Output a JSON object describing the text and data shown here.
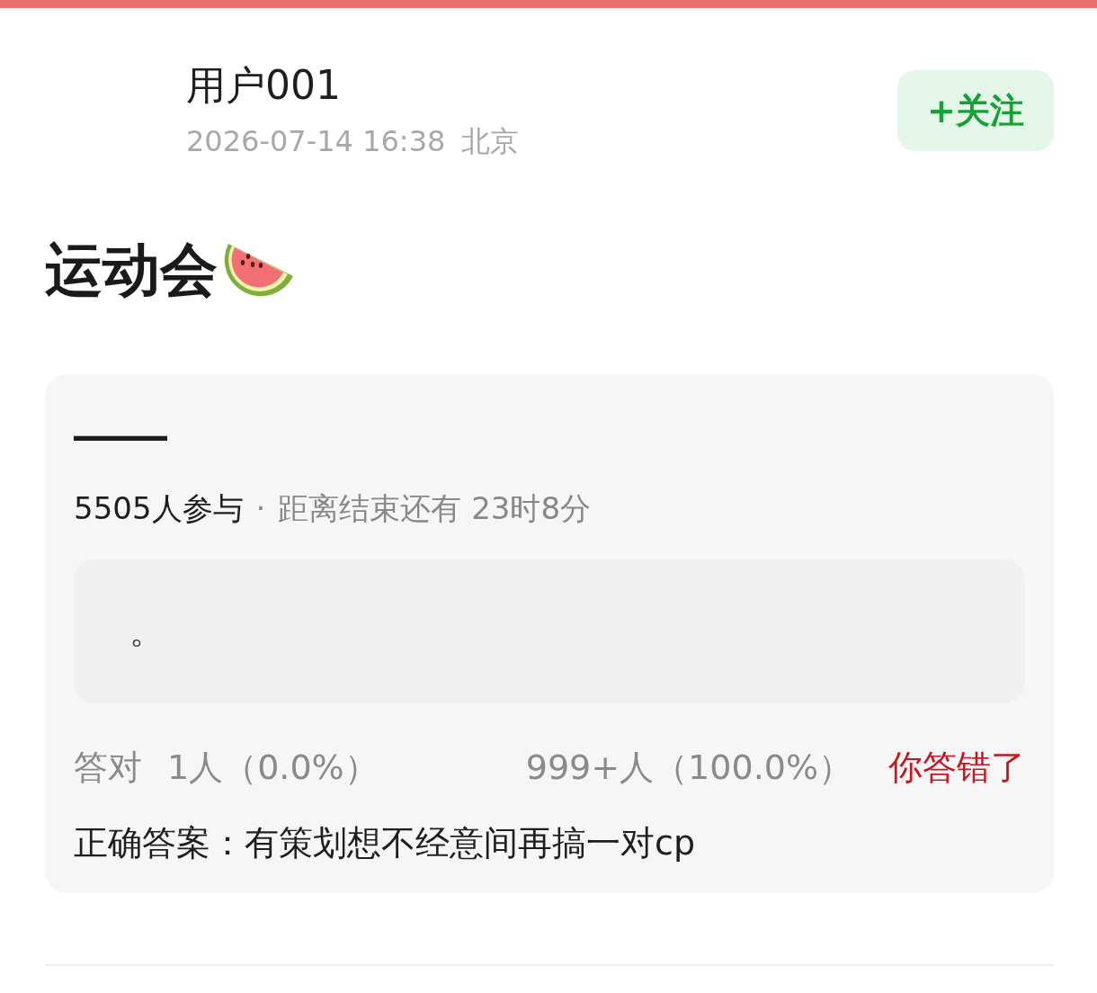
{
  "author": {
    "name": "用户001",
    "date": "2026-07-14 16:38",
    "location": "北京"
  },
  "follow_button": {
    "label": "+关注"
  },
  "title": "运动会",
  "quiz": {
    "question": "——",
    "participants": "5505人参与",
    "separator": "·",
    "countdown": "距离结束还有 23时8分",
    "options": [
      {
        "text": "。"
      }
    ],
    "stats": {
      "label": "答对",
      "correct_count": "1人（0.0%）",
      "wrong_count": "999+人（100.0%）"
    },
    "result": {
      "kind": "wrong",
      "text": "你答错了"
    },
    "correct_answer": "正确答案：有策划想不经意间再搞一对cp"
  }
}
